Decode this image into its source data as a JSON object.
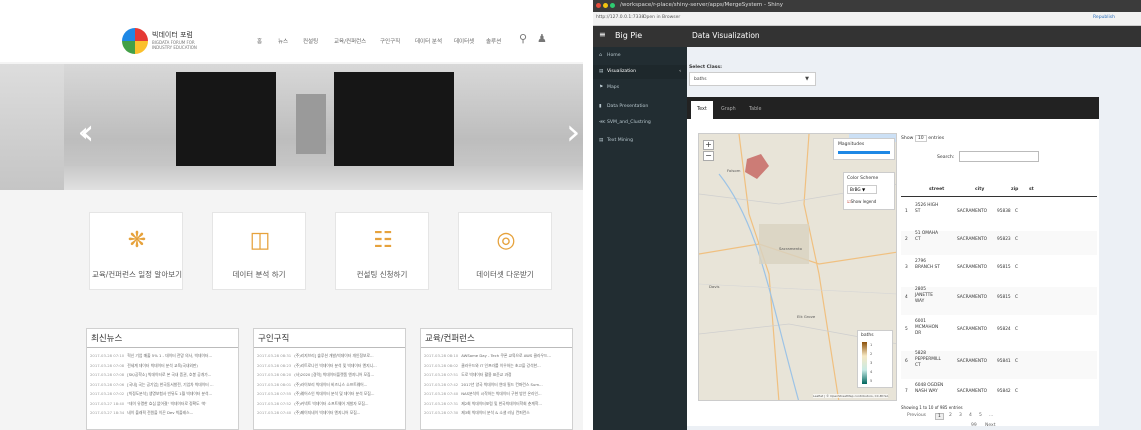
{
  "left": {
    "logo_title": "빅데이터 포럼",
    "logo_sub": "BIGDATA FORUM FOR INDUSTRY EDUCATION",
    "nav": [
      "홈",
      "뉴스",
      "컨설팅",
      "교육/컨퍼런스",
      "구인구직",
      "데이터 분석",
      "데이터셋",
      "솔루션"
    ],
    "cards": [
      {
        "label": "교육/컨퍼런스 일정 알아보기",
        "icon": "people-icon"
      },
      {
        "label": "데이터 분석 하기",
        "icon": "puzzle-icon"
      },
      {
        "label": "컨설팅 신청하기",
        "icon": "consulting-icon"
      },
      {
        "label": "데이터셋 다운받기",
        "icon": "globe-icon"
      }
    ],
    "news": [
      {
        "title": "최신뉴스",
        "rows": [
          {
            "d": "2017-03-28 07:10",
            "t": "혁신 기업 매출 5% 1 - 데이터 전망 의사, 빅데이터..."
          },
          {
            "d": "2017-03-28 07:08",
            "t": "전세계 데이터 빅데이터 분석 교육(국내외판)"
          },
          {
            "d": "2017-03-28 07:08",
            "t": "[SK/공학소] 빅데이터로 본 국내 증권, 호봉 공개가..."
          },
          {
            "d": "2017-03-28 07:06",
            "t": "[국내] 국는 공기업] 한국동서발전, 기업차 빅데이터 ..."
          },
          {
            "d": "2017-03-28 07:02",
            "t": "[빅정도분석] 생명보험사 빈뮤도 1월 빅데이터 분석..."
          },
          {
            "d": "2017-03-27 18:40",
            "t": "\"데이 유명한 효심 없어졌\" 빅데이터로 정확도 '쑥'"
          },
          {
            "d": "2017-03-27 18:34",
            "t": "네이 올래픽 전원을 이끈 Dev 빅플레스..."
          }
        ]
      },
      {
        "title": "구인구직",
        "rows": [
          {
            "d": "2017-03-28 08:31",
            "t": "(주)리지브리] 솔루션 개발/빅데이터 개인정보로..."
          },
          {
            "d": "2017-03-28 08:23",
            "t": "(주)리트로나인 빅데이터 분석 및 빅데이터 엔지니..."
          },
          {
            "d": "2017-03-28 08:20",
            "t": "(사)2020 [경력] 빅데이터플랫폼 엔지니어 모집..."
          },
          {
            "d": "2017-03-28 08:01",
            "t": "(주)라이보리 빅데이터 비즈니스 소프트웨어..."
          },
          {
            "d": "2017-03-28 07:55",
            "t": "(주)웨어스인 빅데이터 분석 및 데이터 분석 모집..."
          },
          {
            "d": "2017-03-28 07:52",
            "t": "(주)커넥트 빅데이터 소프트웨어 개발자 모집..."
          },
          {
            "d": "2017-03-28 07:40",
            "t": "(주)페이지네이 빅데이터 엔지니어 모집..."
          }
        ]
      },
      {
        "title": "교육/컨퍼런스",
        "rows": [
          {
            "d": "2017-03-28 08:10",
            "t": "AWSome Day - Tech 쿠폰 교육으로 AWS 클라우드..."
          },
          {
            "d": "2017-03-28 08:02",
            "t": "클라우드와 IT 인프라를 이우하는 초고을 강석한..."
          },
          {
            "d": "2017-03-28 07:51",
            "t": "도로 빅데이터 활용 표준교 과정"
          },
          {
            "d": "2017-03-28 07:42",
            "t": "2017년 양국 빅데이터 연대 필드 컨퍼런스 Sum..."
          },
          {
            "d": "2017-03-28 07:40",
            "t": "NAS분석이 시작하는 빅데이터 구현 방안 온라인..."
          },
          {
            "d": "2017-03-28 07:31",
            "t": "제2회 빅데이터포럼 및 한국빅데이터학회 춘계학..."
          },
          {
            "d": "2017-03-28 07:30",
            "t": "제3회 빅데이터 분석 & 소셜 러닝 컨퍼런스"
          }
        ]
      }
    ]
  },
  "right": {
    "window_title": "/workspace/r-place/shiny-server/apps/MergeSystem - Shiny",
    "url": "http://127.0.0.1:7338",
    "open_browser": "Open in Browser",
    "republish": "Republish",
    "app_title": "Big Pie",
    "page_title": "Data Visualization",
    "sidebar": [
      {
        "label": "Home",
        "icon": "home-icon"
      },
      {
        "label": "Visualization",
        "icon": "chart-icon",
        "active": true
      },
      {
        "label": "Maps",
        "icon": "flag-icon"
      },
      {
        "label": "Data Presentation",
        "icon": "bar-chart-icon"
      },
      {
        "label": "SVM_and_Clustring",
        "icon": "share-icon"
      },
      {
        "label": "Text Mining",
        "icon": "file-icon"
      }
    ],
    "select_label": "Select Class:",
    "select_value": "baths",
    "tabs": [
      "Text",
      "Graph",
      "Table"
    ],
    "magnitudes_label": "Magnitudes",
    "color_scheme_label": "Color Scheme",
    "color_scheme_value": "BrBG",
    "show_legend_label": "Show legend",
    "legend_title": "baths",
    "legend_ticks": [
      "1",
      "2",
      "3",
      "4",
      "5"
    ],
    "map_attribution": "Leaflet | © OpenStreetMap contributors, CC-BY-SA",
    "map_places": [
      "Folsom",
      "Sacramento",
      "Elk Grove",
      "Davis"
    ],
    "show_label": "Show",
    "show_value": "10",
    "entries_label": "entries",
    "search_label": "Search:",
    "columns": [
      "street",
      "city",
      "zip",
      "st"
    ],
    "rows": [
      {
        "n": "1",
        "street": "3526 HIGH ST",
        "city": "SACRAMENTO",
        "zip": "95838",
        "st": "C"
      },
      {
        "n": "2",
        "street": "51 OMAHA CT",
        "city": "SACRAMENTO",
        "zip": "95823",
        "st": "C"
      },
      {
        "n": "3",
        "street": "2796 BRANCH ST",
        "city": "SACRAMENTO",
        "zip": "95815",
        "st": "C"
      },
      {
        "n": "4",
        "street": "2805 JANETTE WAY",
        "city": "SACRAMENTO",
        "zip": "95815",
        "st": "C"
      },
      {
        "n": "5",
        "street": "6001 MCMAHON DR",
        "city": "SACRAMENTO",
        "zip": "95824",
        "st": "C"
      },
      {
        "n": "6",
        "street": "5828 PEPPERMILL CT",
        "city": "SACRAMENTO",
        "zip": "95841",
        "st": "C"
      },
      {
        "n": "7",
        "street": "6048 OGDEN NASH WAY",
        "city": "SACRAMENTO",
        "zip": "95842",
        "st": "C"
      }
    ],
    "info": "Showing 1 to 10 of 985 entries",
    "pagination": [
      "Previous",
      "1",
      "2",
      "3",
      "4",
      "5",
      "...",
      "99",
      "Next"
    ]
  }
}
